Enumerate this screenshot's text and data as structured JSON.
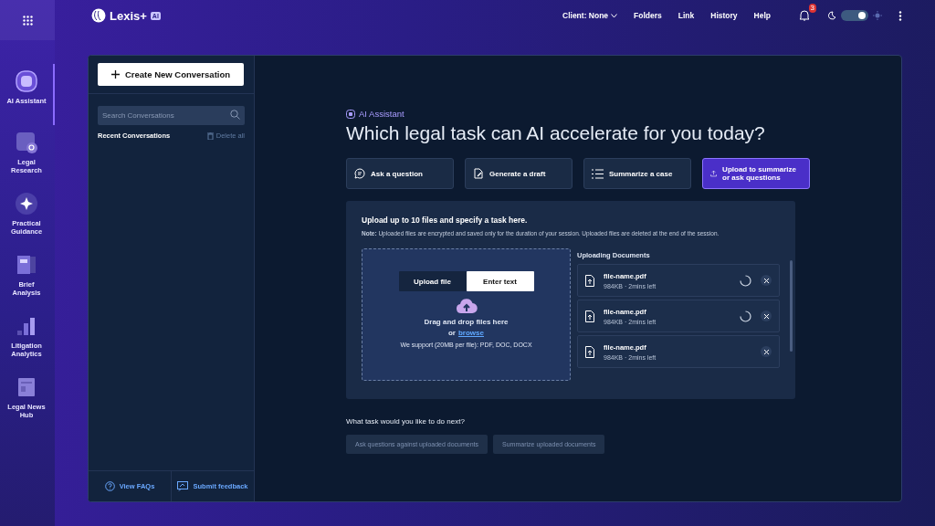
{
  "header": {
    "logo": "Lexis+",
    "logo_badge": "AI",
    "nav": [
      {
        "label": "Client: None",
        "kind": "dropdown"
      },
      {
        "label": "Folders",
        "kind": "link"
      },
      {
        "label": "Link",
        "kind": "link"
      },
      {
        "label": "History",
        "kind": "link"
      },
      {
        "label": "Help",
        "kind": "link"
      }
    ],
    "notification_count": "3",
    "dark_mode": true
  },
  "rail": [
    {
      "label": "AI Assistant",
      "selected": true
    },
    {
      "label": "Legal Research",
      "selected": false
    },
    {
      "label": "Practical Guidance",
      "selected": false
    },
    {
      "label": "Brief Analysis",
      "selected": false
    },
    {
      "label": "Litigation Analytics",
      "selected": false
    },
    {
      "label": "Legal News Hub",
      "selected": false
    }
  ],
  "conversations": {
    "create_button": "Create New Conversation",
    "search": {
      "placeholder": "Search Conversations"
    },
    "recent_title": "Recent Conversations",
    "delete_all": {
      "label": "Delete all",
      "disabled": true
    },
    "footer": [
      "View FAQs",
      "Submit feedback"
    ]
  },
  "assistant": {
    "eyebrow": "AI Assistant",
    "heading": "Which legal task can AI accelerate for you today?",
    "tasks": [
      {
        "label": "Ask a question",
        "selected": false
      },
      {
        "label": "Generate a draft",
        "selected": false
      },
      {
        "label": "Summarize a case",
        "selected": false
      },
      {
        "label": "Upload to summarize or ask questions",
        "selected": true
      }
    ],
    "upload": {
      "title": "Upload up to 10 files and specify a task here.",
      "note": "**Note:** Uploaded files are encrypted and saved only for the duration of your session. Uploaded files are deleted at the end of the session.",
      "tabs": [
        {
          "label": "Upload file",
          "selected": false
        },
        {
          "label": "Enter text",
          "selected": true
        }
      ],
      "drop_text": "Drag and drop files here",
      "or": "or",
      "browse": "browse",
      "support": "We support (20MB per file): PDF, DOC, DOCX",
      "list_title": "Uploading Documents",
      "files": [
        {
          "name": "file-name.pdf",
          "meta": "984KB · 2mins left",
          "loading": true
        },
        {
          "name": "file-name.pdf",
          "meta": "984KB · 2mins left",
          "loading": true
        },
        {
          "name": "file-name.pdf",
          "meta": "984KB · 2mins left",
          "loading": false
        }
      ]
    },
    "next_title": "What task would you like to do next?",
    "next_actions": [
      {
        "label": "Ask questions against uploaded documents",
        "disabled": true
      },
      {
        "label": "Summarize uploaded documents",
        "disabled": true
      }
    ]
  }
}
